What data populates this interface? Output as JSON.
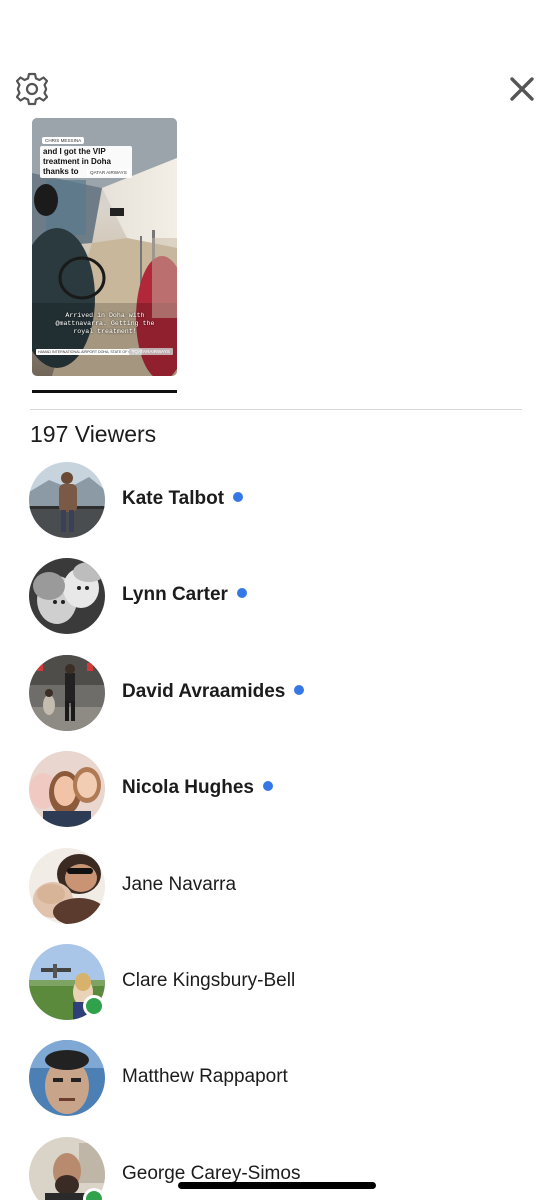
{
  "header": {
    "settings_icon": "gear-icon",
    "close_icon": "close-icon"
  },
  "story": {
    "author_tag": "CHRIS MESSINA",
    "caption": "and I got the VIP treatment in Doha thanks to",
    "mention_tag": "QATAR AIRWAYS",
    "overlay_text": "Arrived in Doha with @mattnavarra. Getting the royal treatment!",
    "location": "HAMAD INTERNATIONAL AIRPORT DOHA, STATE OF QATAR",
    "hashtag": "#QATARAIRWAYS"
  },
  "viewers_header": "197 Viewers",
  "viewers": [
    {
      "name": "Kate Talbot",
      "bold": true,
      "unseen": true,
      "online": false
    },
    {
      "name": "Lynn Carter",
      "bold": true,
      "unseen": true,
      "online": false
    },
    {
      "name": "David Avraamides",
      "bold": true,
      "unseen": true,
      "online": false
    },
    {
      "name": "Nicola Hughes",
      "bold": true,
      "unseen": true,
      "online": false
    },
    {
      "name": "Jane Navarra",
      "bold": false,
      "unseen": false,
      "online": false
    },
    {
      "name": "Clare Kingsbury-Bell",
      "bold": false,
      "unseen": false,
      "online": true
    },
    {
      "name": "Matthew Rappaport",
      "bold": false,
      "unseen": false,
      "online": false
    },
    {
      "name": "George Carey-Simos",
      "bold": false,
      "unseen": false,
      "online": true
    }
  ],
  "colors": {
    "unseen_dot": "#3578e5",
    "online_dot": "#31a24c"
  }
}
